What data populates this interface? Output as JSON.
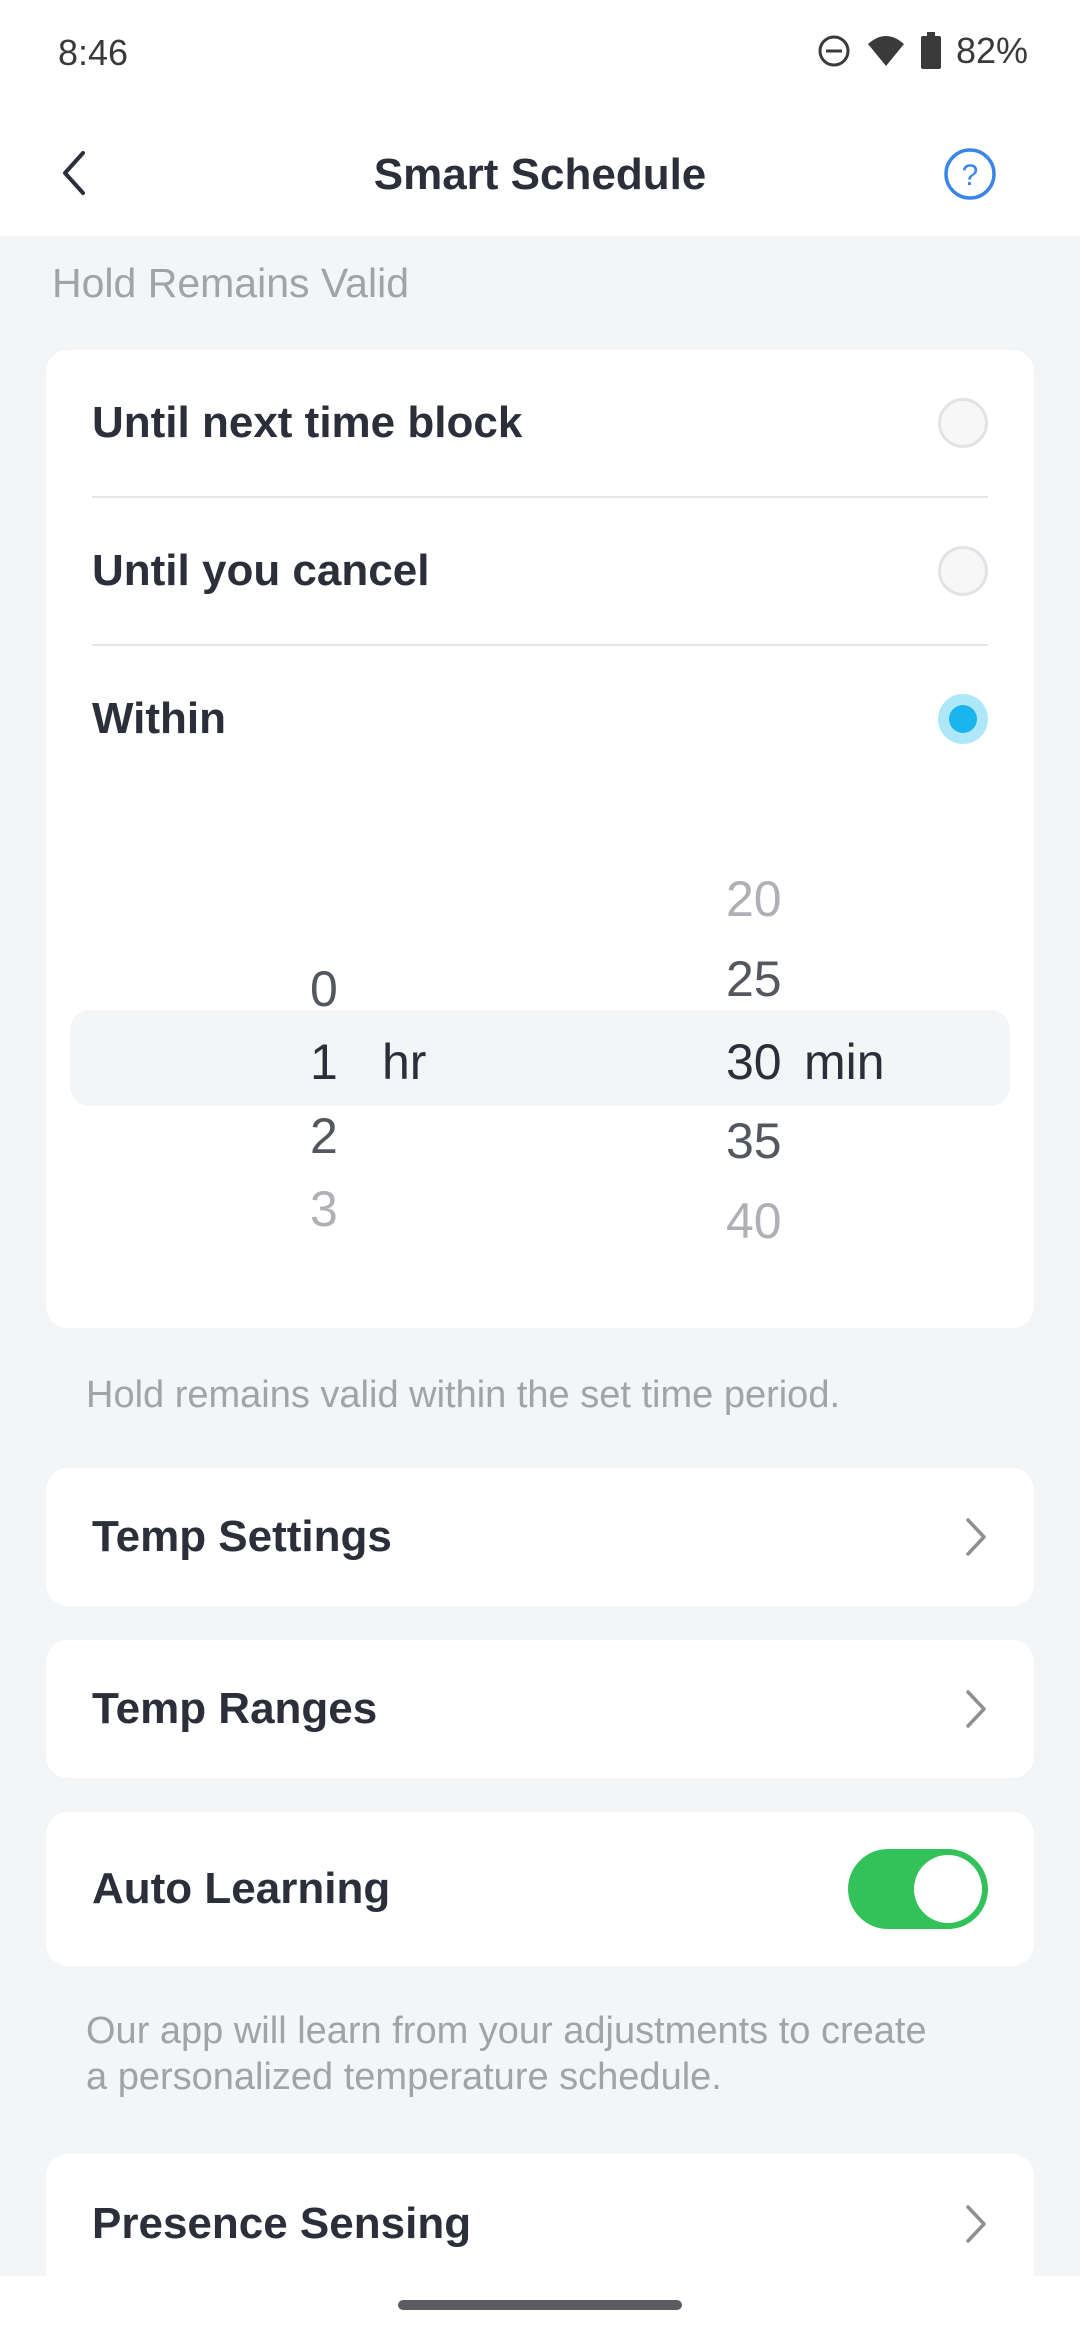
{
  "status": {
    "time": "8:46",
    "battery": "82%"
  },
  "header": {
    "title": "Smart Schedule"
  },
  "hold": {
    "section_label": "Hold Remains Valid",
    "options": [
      {
        "label": "Until next time block",
        "selected": false
      },
      {
        "label": "Until you cancel",
        "selected": false
      },
      {
        "label": "Within",
        "selected": true
      }
    ],
    "hours": {
      "items": [
        "0",
        "1",
        "2",
        "3"
      ],
      "selected": "1",
      "unit": "hr"
    },
    "minutes": {
      "items": [
        "20",
        "25",
        "30",
        "35",
        "40"
      ],
      "selected": "30",
      "unit": "min"
    },
    "hint": "Hold remains valid within the set time period."
  },
  "temp_settings": {
    "label": "Temp Settings"
  },
  "temp_ranges": {
    "label": "Temp Ranges"
  },
  "auto_learning": {
    "label": "Auto Learning",
    "enabled": true,
    "hint_line1": "Our app will learn from your adjustments to create",
    "hint_line2": "a personalized temperature schedule."
  },
  "presence": {
    "label": "Presence Sensing"
  },
  "colors": {
    "accent_blue": "#3a86e8",
    "radio_on": "#19b5ee",
    "toggle_on": "#33c25a"
  },
  "icons": [
    "dnd-icon",
    "wifi-icon",
    "battery-icon",
    "back-chevron-icon",
    "help-icon",
    "chevron-right-icon"
  ]
}
